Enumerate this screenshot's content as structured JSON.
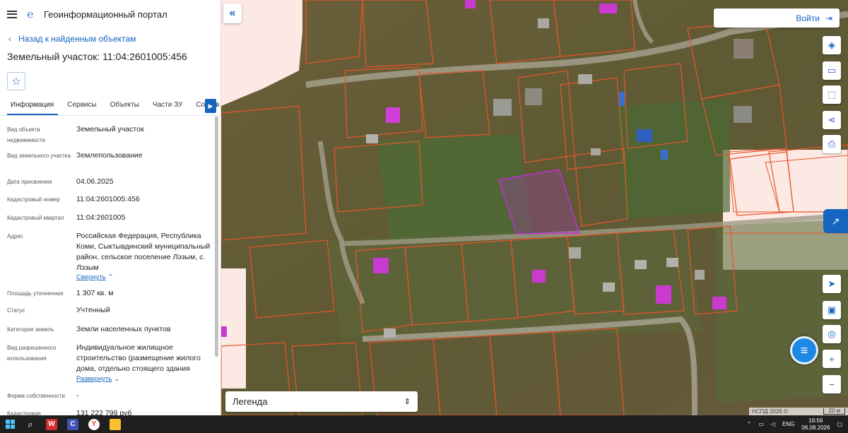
{
  "header": {
    "title": "Геоинформационный портал"
  },
  "nav": {
    "back_label": "Назад к найденным объектам"
  },
  "object": {
    "title": "Земельный участок: 11:04:2601005:456"
  },
  "tabs": [
    "Информация",
    "Сервисы",
    "Объекты",
    "Части ЗУ",
    "Состав"
  ],
  "info": {
    "rows": [
      {
        "label": "Вид объекта недвижимости",
        "value": "Земельный участок"
      },
      {
        "label": "Вид земельного участка",
        "value": "Землепользование"
      },
      {
        "label": "Дата присвоения",
        "value": "04.06.2025"
      },
      {
        "label": "Кадастровый номер",
        "value": "11:04:2601005:456"
      },
      {
        "label": "Кадастровый квартал",
        "value": "11:04:2601005"
      },
      {
        "label": "Адрес",
        "value": "Российская Федерация, Республика Коми, Сыктывдинский муниципальный район, сельское поселение Лэзым, с. Лэзым"
      },
      {
        "label": "Площадь уточненная",
        "value": "1 307 кв. м"
      },
      {
        "label": "Статус",
        "value": "Учтенный"
      },
      {
        "label": "Категория земель",
        "value": "Земли населенных пунктов"
      },
      {
        "label": "Вид разрешенного использования",
        "value": "Индивидуальное жилищное строительство (размещение жилого дома, отдельно стоящего здания"
      },
      {
        "label": "Форма собственности",
        "value": "-"
      },
      {
        "label": "Кадастровая",
        "value": "131 222 799 руб"
      }
    ],
    "collapse_label": "Свернуть",
    "expand_label": "Развернуть"
  },
  "map": {
    "login_label": "Войти",
    "legend_label": "Легенда",
    "attribution": "НСПД 2026 ©",
    "scale": "20 м"
  },
  "taskbar": {
    "lang": "ENG",
    "time": "16:56",
    "date": "06.08.2026"
  },
  "colors": {
    "accent": "#1565c0",
    "parcel": "#e8552a",
    "selected": "#b833c8"
  }
}
